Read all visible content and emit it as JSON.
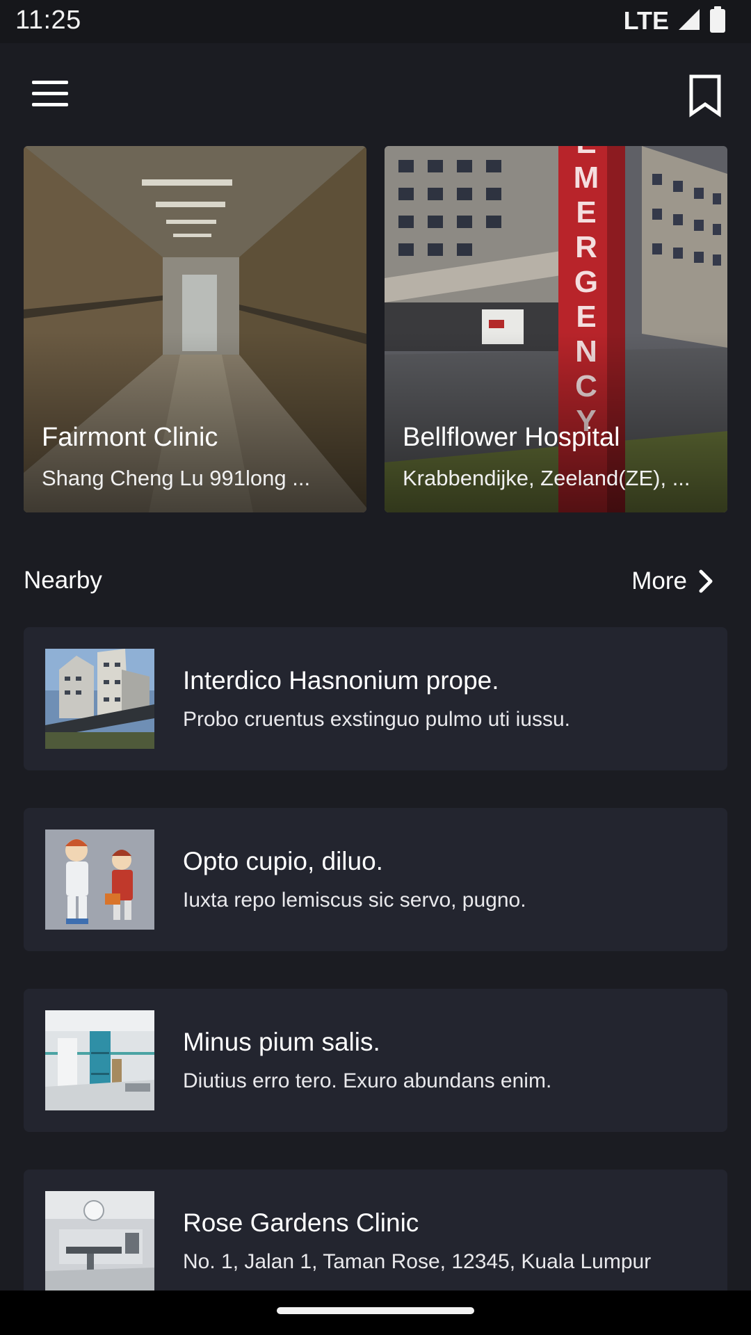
{
  "status_bar": {
    "time": "11:25",
    "network": "LTE"
  },
  "app_bar": {
    "menu_icon": "menu-icon",
    "bookmark_icon": "bookmark-icon"
  },
  "featured": [
    {
      "title": "Fairmont Clinic",
      "subtitle": "Shang Cheng Lu 991long ..."
    },
    {
      "title": "Bellflower Hospital",
      "subtitle": "Krabbendijke, Zeeland(ZE), ..."
    }
  ],
  "nearby": {
    "label": "Nearby",
    "more_label": "More",
    "items": [
      {
        "title": "Interdico Hasnonium prope.",
        "subtitle": "Probo cruentus exstinguo pulmo uti iussu."
      },
      {
        "title": "Opto cupio, diluo.",
        "subtitle": "Iuxta repo lemiscus sic servo, pugno."
      },
      {
        "title": "Minus pium salis.",
        "subtitle": "Diutius erro tero. Exuro abundans enim."
      },
      {
        "title": "Rose Gardens Clinic",
        "subtitle": "No. 1, Jalan 1, Taman Rose, 12345, Kuala Lumpur"
      }
    ]
  },
  "colors": {
    "background": "#1b1c22",
    "card": "#23252f",
    "status_bar": "#16171b",
    "emergency_red": "#b8242a"
  }
}
